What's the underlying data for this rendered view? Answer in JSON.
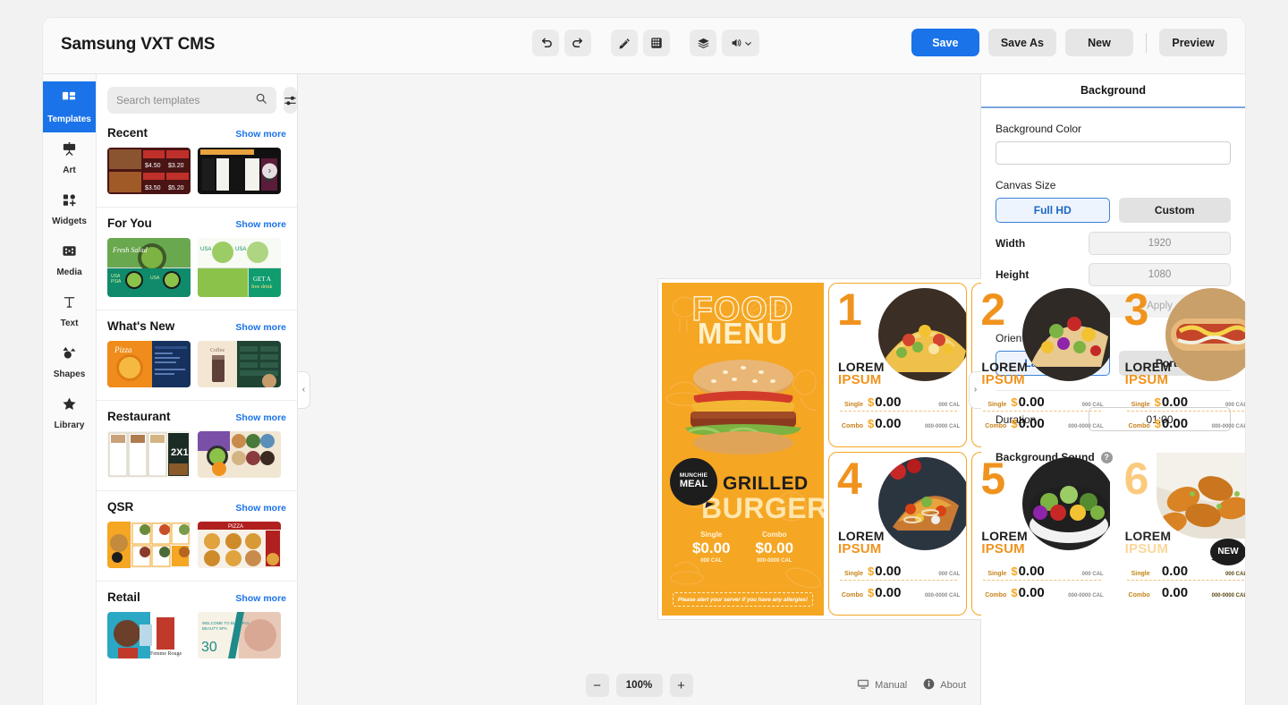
{
  "app": {
    "title": "Samsung VXT CMS"
  },
  "toolbar": {
    "icons": [
      {
        "name": "undo-icon",
        "glyph": "↶"
      },
      {
        "name": "redo-icon",
        "glyph": "↷"
      },
      {
        "name": "ruler-pencil-icon",
        "glyph": "📏"
      },
      {
        "name": "grid-table-icon",
        "glyph": "▦"
      },
      {
        "name": "layers-icon",
        "glyph": "❖"
      },
      {
        "name": "volume-icon",
        "glyph": "🔊"
      }
    ],
    "save_label": "Save",
    "save_as_label": "Save As",
    "new_label": "New",
    "preview_label": "Preview",
    "accent_color": "#1a73e8"
  },
  "sidebar": {
    "items": [
      {
        "label": "Templates",
        "icon": "templates-icon",
        "active": true
      },
      {
        "label": "Art",
        "icon": "art-easel-icon",
        "active": false
      },
      {
        "label": "Widgets",
        "icon": "widgets-icon",
        "active": false
      },
      {
        "label": "Media",
        "icon": "media-icon",
        "active": false
      },
      {
        "label": "Text",
        "icon": "text-icon",
        "active": false
      },
      {
        "label": "Shapes",
        "icon": "shapes-icon",
        "active": false
      },
      {
        "label": "Library",
        "icon": "star-library-icon",
        "active": false
      }
    ]
  },
  "templates_panel": {
    "search_placeholder": "Search templates",
    "search_value": "",
    "filter_icon": "filter-sliders-icon",
    "show_more_label": "Show more",
    "sections": [
      {
        "title": "Recent"
      },
      {
        "title": "For You"
      },
      {
        "title": "What's New"
      },
      {
        "title": "Restaurant"
      },
      {
        "title": "QSR"
      },
      {
        "title": "Retail"
      }
    ]
  },
  "canvas": {
    "collapse_left_glyph": "‹",
    "collapse_right_glyph": "›",
    "zoom_out_glyph": "−",
    "zoom_in_glyph": "+",
    "zoom_level": "100%",
    "manual_label": "Manual",
    "about_label": "About",
    "manual_icon": "monitor-manual-icon",
    "about_icon": "info-circle-icon"
  },
  "design": {
    "hero": {
      "line1": "FOOD",
      "line2": "MENU",
      "badge_line1": "MUNCHIE",
      "badge_line2": "MEAL",
      "item_line1": "GRILLED",
      "item_line2": "BURGER",
      "single_label": "Single",
      "single_price": "$0.00",
      "single_cal": "000 CAL",
      "combo_label": "Combo",
      "combo_price": "$0.00",
      "combo_cal": "000-0000 CAL",
      "allergy_note": "Please alert your server if you have any allergies!",
      "bg_color": "#f5a623"
    },
    "labels": {
      "single": "Single",
      "combo": "Combo",
      "currency": "$",
      "price": "0.00",
      "single_cal": "000 CAL",
      "combo_cal": "000-0000 CAL",
      "new_badge": "NEW"
    },
    "cards": [
      {
        "number": "1",
        "name_line1": "LOREM",
        "name_line2": "IPSUM",
        "filled": false,
        "new": false,
        "img": "taco"
      },
      {
        "number": "2",
        "name_line1": "LOREM",
        "name_line2": "IPSUM",
        "filled": false,
        "new": false,
        "img": "wrap"
      },
      {
        "number": "3",
        "name_line1": "LOREM",
        "name_line2": "IPSUM",
        "filled": false,
        "new": false,
        "img": "hotdog"
      },
      {
        "number": "4",
        "name_line1": "LOREM",
        "name_line2": "IPSUM",
        "filled": false,
        "new": false,
        "img": "pizza"
      },
      {
        "number": "5",
        "name_line1": "LOREM",
        "name_line2": "IPSUM",
        "filled": false,
        "new": false,
        "img": "salad"
      },
      {
        "number": "6",
        "name_line1": "LOREM",
        "name_line2": "IPSUM",
        "filled": true,
        "new": true,
        "img": "chicken"
      }
    ]
  },
  "properties": {
    "panel_title": "Background",
    "bg_color_label": "Background Color",
    "bg_color_value": "",
    "canvas_size_label": "Canvas Size",
    "size_fullhd": "Full HD",
    "size_custom": "Custom",
    "width_label": "Width",
    "width_value": "1920",
    "height_label": "Height",
    "height_value": "1080",
    "apply_label": "Apply",
    "orientation_label": "Orientation",
    "orientation_landscape": "Landscape",
    "orientation_portrait": "Portrait",
    "duration_label": "Duration",
    "duration_value": "01:00",
    "bg_sound_label": "Background Sound",
    "help_glyph": "?"
  }
}
